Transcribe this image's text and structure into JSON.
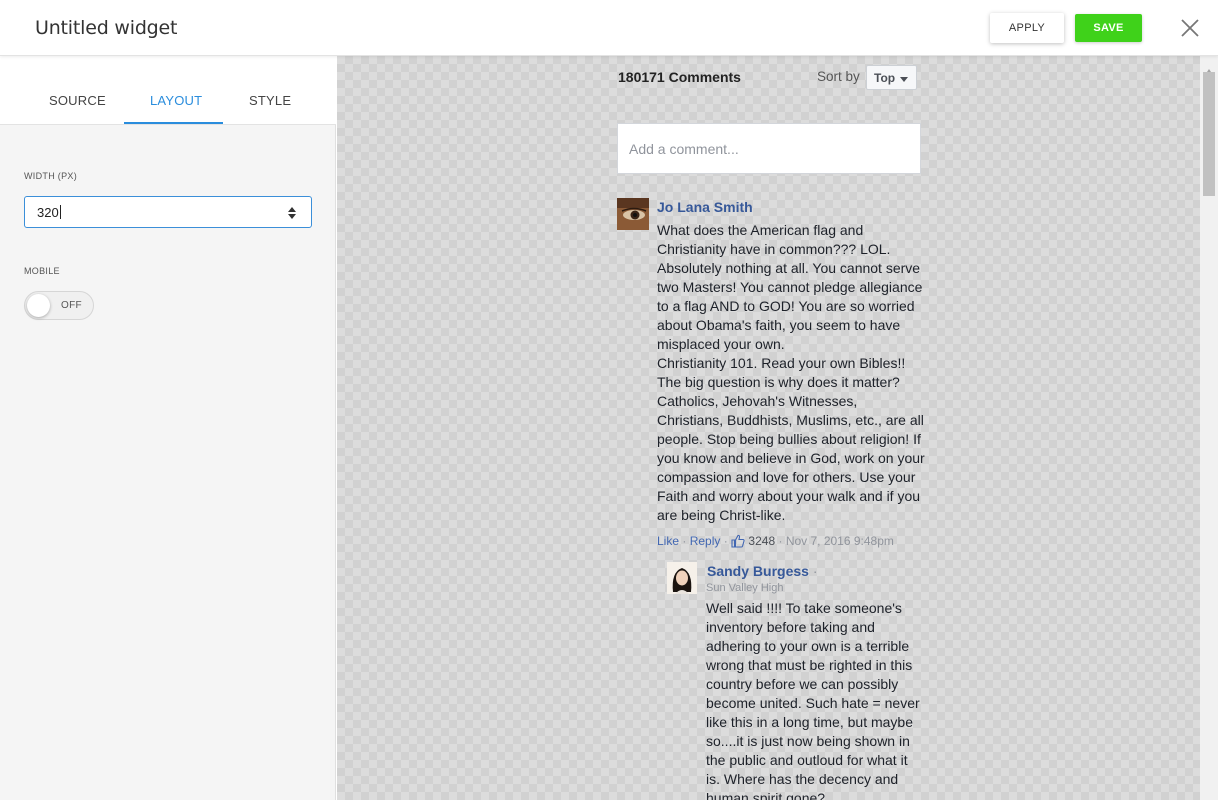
{
  "header": {
    "title": "Untitled widget",
    "apply_label": "APPLY",
    "save_label": "SAVE"
  },
  "left_panel": {
    "tabs": [
      {
        "label": "SOURCE"
      },
      {
        "label": "LAYOUT"
      },
      {
        "label": "STYLE"
      }
    ],
    "width_label": "WIDTH (PX)",
    "width_value": "320",
    "mobile_label": "MOBILE",
    "mobile_state": "OFF"
  },
  "preview": {
    "comments_count": "180171 Comments",
    "sort_label": "Sort by",
    "sort_value": "Top",
    "comment_placeholder": "Add a comment...",
    "comments": [
      {
        "author": "Jo Lana Smith",
        "text": "What does the American flag and Christianity have in common??? LOL. Absolutely nothing at all. You cannot serve two Masters! You cannot pledge allegiance to a flag AND to GOD! You are so worried about Obama's faith, you seem to have misplaced your own.\nChristianity 101. Read your own Bibles!!\nThe big question is why does it matter? Catholics, Jehovah's Witnesses, Christians, Buddhists, Muslims, etc., are all people. Stop being bullies about religion! If you know and believe in God, work on your compassion and love for others. Use your Faith and worry about your walk and if you are being Christ-like.",
        "like": "Like",
        "reply": "Reply",
        "likes": "3248",
        "date": "Nov 7, 2016 9:48pm"
      },
      {
        "author": "Sandy Burgess",
        "author_suffix": " ·",
        "affiliation": "Sun Valley High",
        "text": "Well said !!!! To take someone's inventory before taking and adhering to your own is a terrible wrong that must be righted in this country before we can possibly become united. Such hate = never like this in a long time, but maybe so....it is just now being shown in the public and outloud for what it is. Where has the decency and human spirit gone?"
      }
    ]
  },
  "icons": {
    "close": "close-icon",
    "spinner": "spinner-arrows-icon",
    "thumb": "thumbs-up-icon",
    "dropdown": "caret-down-icon"
  },
  "colors": {
    "accent": "#2a8ddd",
    "save": "#3fd21a",
    "author_link": "#365899"
  }
}
